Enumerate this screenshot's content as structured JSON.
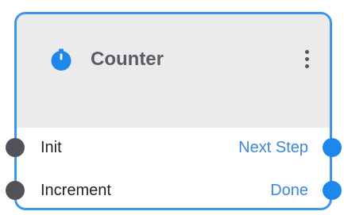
{
  "node": {
    "title": "Counter",
    "icon": "stopwatch-icon",
    "menu_icon": "vertical-ellipsis-icon",
    "inputs": [
      {
        "label": "Init"
      },
      {
        "label": "Increment"
      }
    ],
    "outputs": [
      {
        "label": "Next Step"
      },
      {
        "label": "Done"
      }
    ]
  },
  "colors": {
    "border": "#3d96eb",
    "header_bg": "#ebebeb",
    "input_port": "#52535a",
    "output_port": "#1e87ec",
    "output_label": "#3d86d8"
  }
}
